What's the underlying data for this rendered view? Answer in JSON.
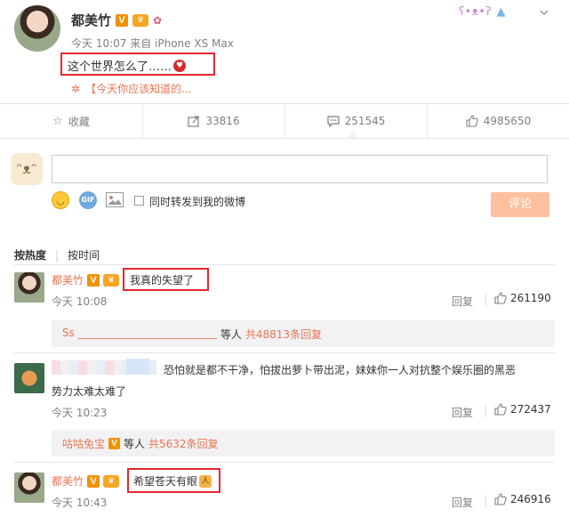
{
  "post": {
    "username": "都美竹",
    "meta": "今天 10:07 来自 iPhone XS Max",
    "text": "这个世界怎么了……",
    "link": "【今天你应该知道的..."
  },
  "actions": {
    "favorite": "收藏",
    "forward": "33816",
    "comment": "251545",
    "like": "4985650"
  },
  "composer": {
    "sync_label": "同时转发到我的微博",
    "submit": "评论"
  },
  "sort": {
    "hot": "按热度",
    "time": "按时间"
  },
  "comments": [
    {
      "user": "都美竹",
      "text": "我真的失望了",
      "time": "今天 10:08",
      "reply": "回复",
      "likes": "261190",
      "thread": {
        "user": "Ss",
        "line": "__________________________",
        "suffix": "等人",
        "count": "共48813条回复"
      }
    },
    {
      "user": "",
      "text_line1": "恐怕就是都不干净，怕拔出萝卜带出泥，妹妹你一人对抗整个娱乐圈的黑恶",
      "text_line2": "势力太难太难了",
      "time": "今天 10:23",
      "reply": "回复",
      "likes": "272437",
      "thread": {
        "user": "咕咕兔宝",
        "suffix": "等人",
        "count": "共5632条回复"
      }
    },
    {
      "user": "都美竹",
      "text": "希望苍天有眼",
      "time": "今天 10:43",
      "reply": "回复",
      "likes": "246916"
    }
  ],
  "colors": {
    "accent": "#eb7350",
    "highlight": "#e5282d",
    "submit": "#ffc09f"
  }
}
